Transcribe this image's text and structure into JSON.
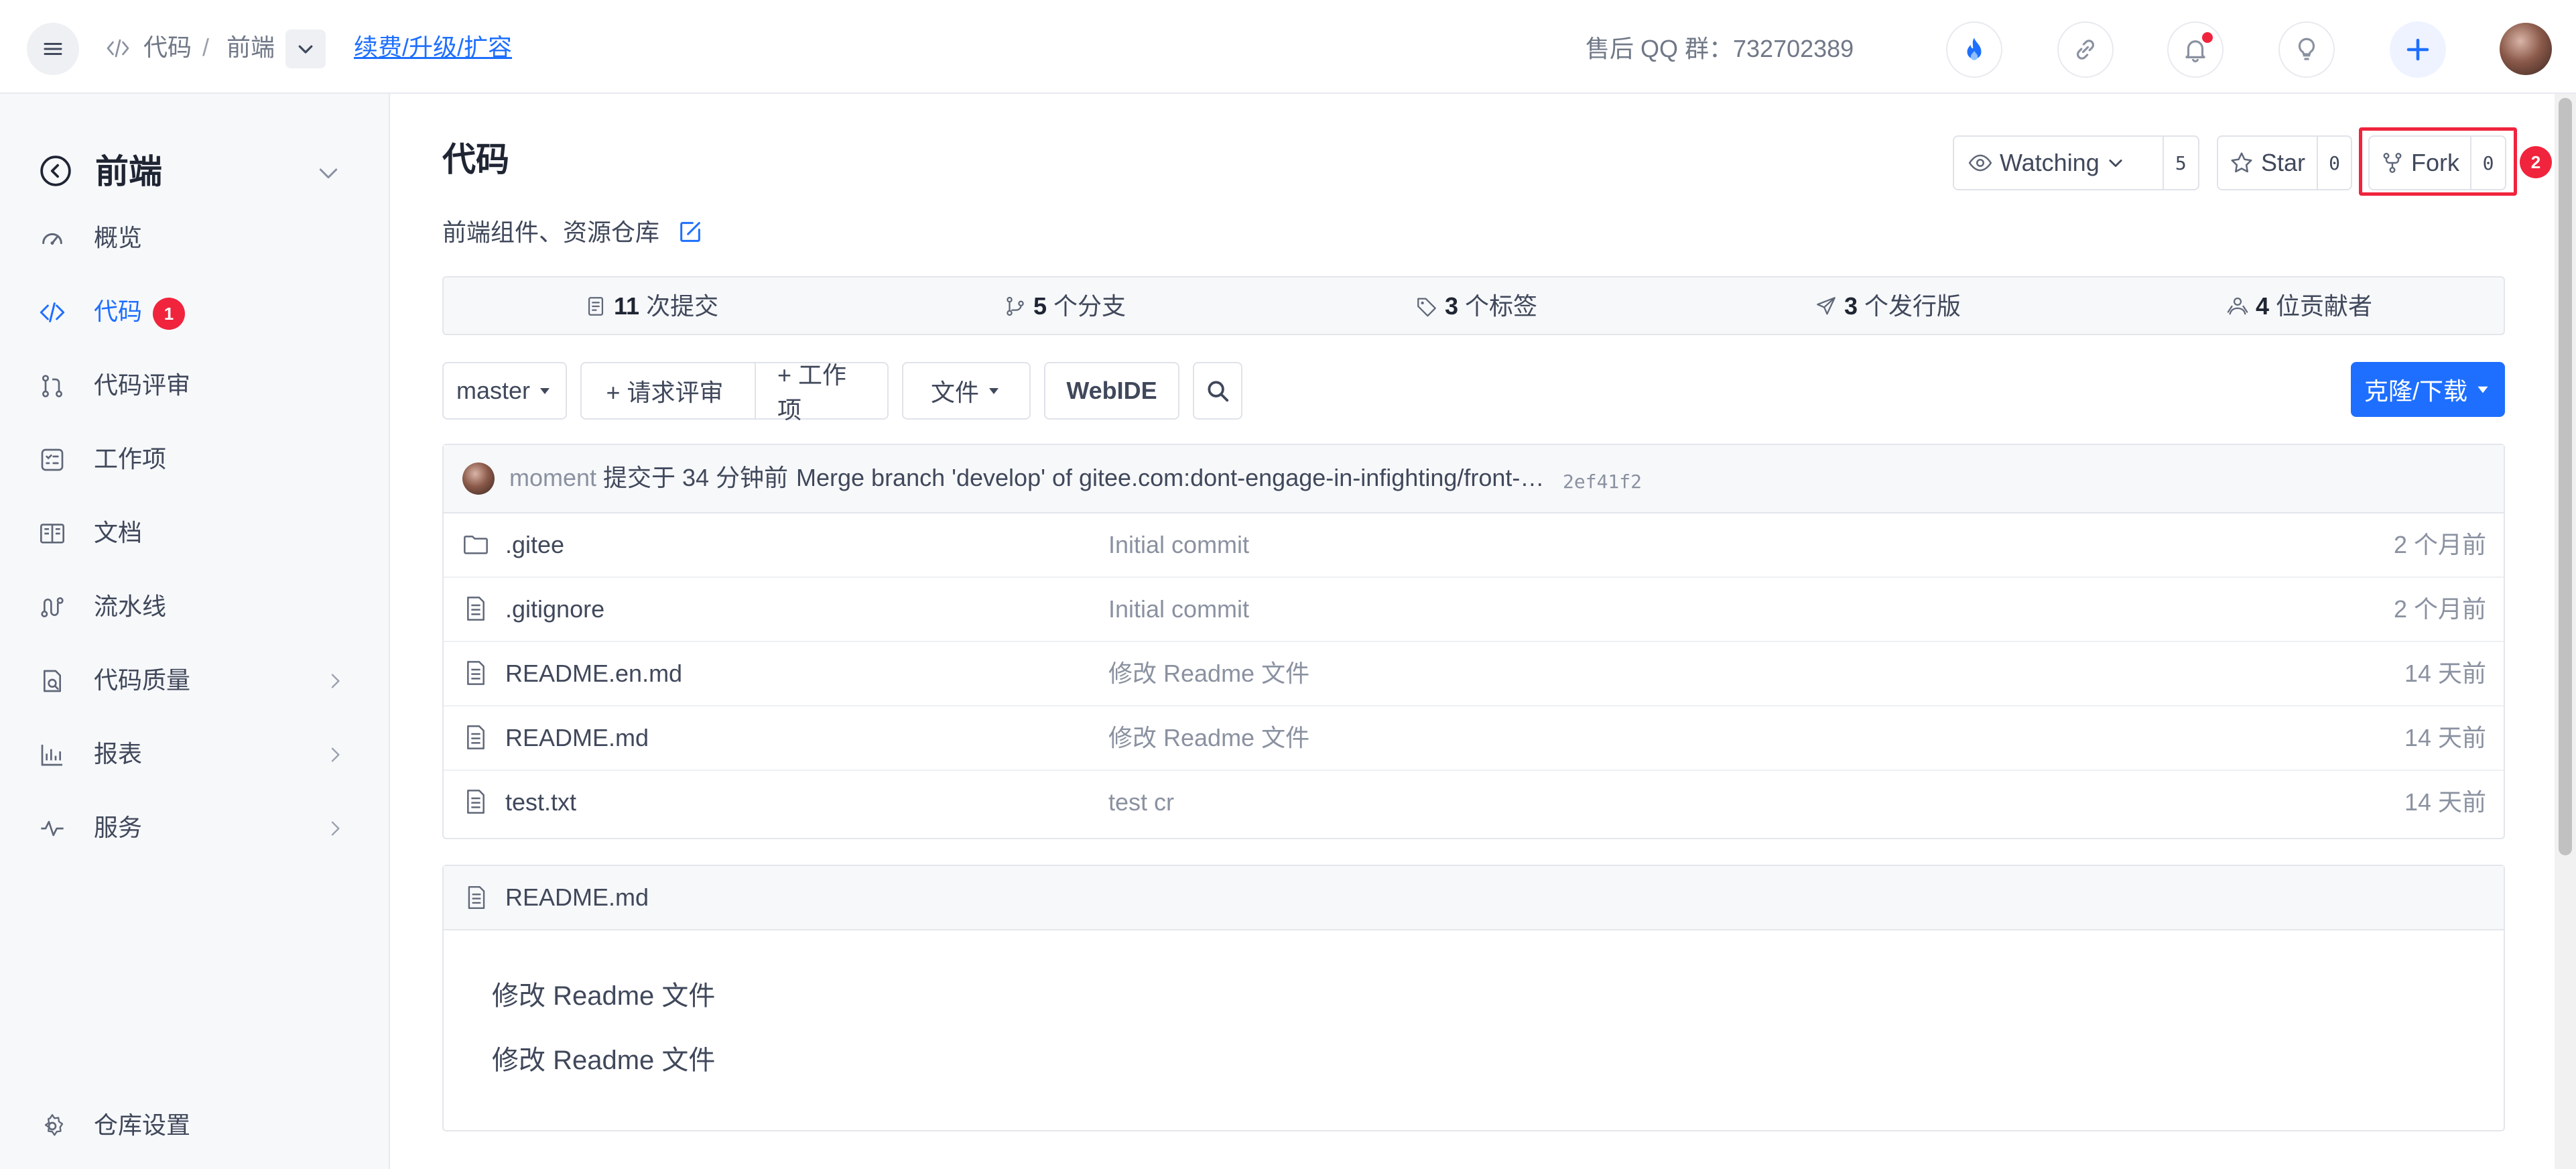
{
  "header": {
    "breadcrumb": {
      "code": "代码",
      "separator": "/",
      "project": "前端"
    },
    "renew_link": "续费/升级/扩容",
    "qq_group": "售后 QQ 群：732702389"
  },
  "sidebar": {
    "title": "前端",
    "items": [
      {
        "label": "概览",
        "icon": "gauge-icon"
      },
      {
        "label": "代码",
        "icon": "code-icon",
        "active": true,
        "badge": "1"
      },
      {
        "label": "代码评审",
        "icon": "pull-request-icon"
      },
      {
        "label": "工作项",
        "icon": "task-list-icon"
      },
      {
        "label": "文档",
        "icon": "book-icon"
      },
      {
        "label": "流水线",
        "icon": "pipeline-icon"
      },
      {
        "label": "代码质量",
        "icon": "quality-icon",
        "expandable": true
      },
      {
        "label": "报表",
        "icon": "bar-chart-icon",
        "expandable": true
      },
      {
        "label": "服务",
        "icon": "pulse-icon",
        "expandable": true
      }
    ],
    "settings_label": "仓库设置"
  },
  "repo": {
    "title": "代码",
    "description": "前端组件、资源仓库",
    "watch": {
      "label": "Watching",
      "count": "5"
    },
    "star": {
      "label": "Star",
      "count": "0"
    },
    "fork": {
      "label": "Fork",
      "count": "0",
      "badge": "2"
    }
  },
  "stats": [
    {
      "num": "11",
      "label": "次提交",
      "icon": "commit-icon"
    },
    {
      "num": "5",
      "label": "个分支",
      "icon": "branch-icon"
    },
    {
      "num": "3",
      "label": "个标签",
      "icon": "tag-icon"
    },
    {
      "num": "3",
      "label": "个发行版",
      "icon": "release-icon"
    },
    {
      "num": "4",
      "label": "位贡献者",
      "icon": "contributors-icon"
    }
  ],
  "toolbar": {
    "branch": "master",
    "pull_request": "+ 请求评审",
    "work_item": "+ 工作项",
    "file": "文件",
    "webide": "WebIDE",
    "clone": "克隆/下载"
  },
  "last_commit": {
    "user": "moment",
    "time": "提交于 34 分钟前",
    "message": "Merge branch 'develop' of gitee.com:dont-engage-in-infighting/front-en...",
    "hash": "2ef41f2"
  },
  "files": [
    {
      "name": ".gitee",
      "type": "folder",
      "message": "Initial commit",
      "time": "2 个月前"
    },
    {
      "name": ".gitignore",
      "type": "file",
      "message": "Initial commit",
      "time": "2 个月前"
    },
    {
      "name": "README.en.md",
      "type": "file",
      "message": "修改 Readme 文件",
      "time": "14 天前"
    },
    {
      "name": "README.md",
      "type": "file",
      "message": "修改 Readme 文件",
      "time": "14 天前"
    },
    {
      "name": "test.txt",
      "type": "file",
      "message": "test cr",
      "time": "14 天前"
    }
  ],
  "readme": {
    "filename": "README.md",
    "lines": [
      "修改 Readme 文件",
      "修改 Readme 文件"
    ]
  },
  "colors": {
    "accent": "#1e6fff",
    "badge": "#f0243d",
    "highlight_border": "#f0243d"
  }
}
